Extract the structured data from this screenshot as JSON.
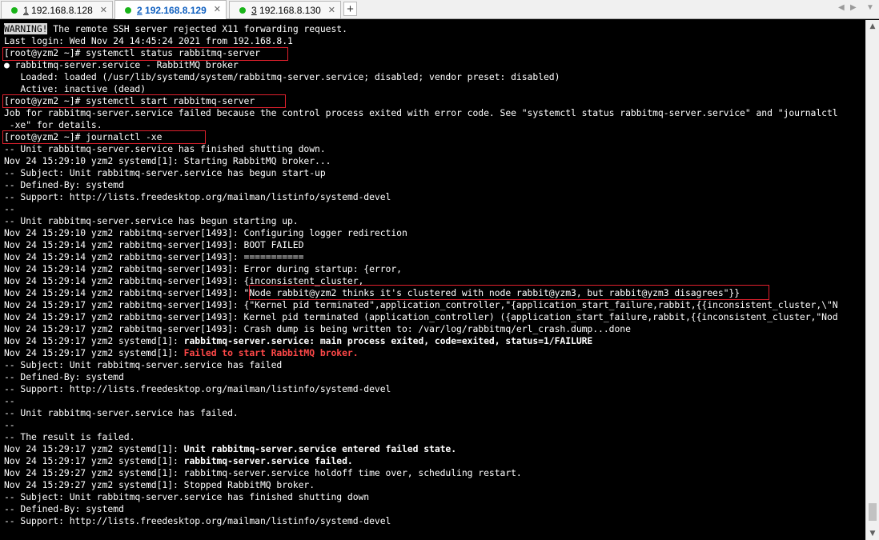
{
  "tabs": [
    {
      "num": "1",
      "label": " 192.168.8.128",
      "close": "✕",
      "status": "connected"
    },
    {
      "num": "2",
      "label": " 192.168.8.129",
      "close": "✕",
      "status": "connected"
    },
    {
      "num": "3",
      "label": " 192.168.8.130",
      "close": "✕",
      "status": "connected"
    }
  ],
  "add_tab": "+",
  "nav": {
    "prev": "◀",
    "next": "▶",
    "menu": "▼"
  },
  "terminal": {
    "warning_tag": "WARNING!",
    "warning_rest": " The remote SSH server rejected X11 forwarding request.",
    "lines": [
      "Last login: Wed Nov 24 14:45:24 2021 from 192.168.8.1",
      "[root@yzm2 ~]# systemctl status rabbitmq-server",
      "● rabbitmq-server.service - RabbitMQ broker",
      "   Loaded: loaded (/usr/lib/systemd/system/rabbitmq-server.service; disabled; vendor preset: disabled)",
      "   Active: inactive (dead)",
      "[root@yzm2 ~]# systemctl start rabbitmq-server",
      "Job for rabbitmq-server.service failed because the control process exited with error code. See \"systemctl status rabbitmq-server.service\" and \"journalctl",
      " -xe\" for details.",
      "[root@yzm2 ~]# journalctl -xe",
      "-- Unit rabbitmq-server.service has finished shutting down.",
      "Nov 24 15:29:10 yzm2 systemd[1]: Starting RabbitMQ broker...",
      "-- Subject: Unit rabbitmq-server.service has begun start-up",
      "-- Defined-By: systemd",
      "-- Support: http://lists.freedesktop.org/mailman/listinfo/systemd-devel",
      "--",
      "-- Unit rabbitmq-server.service has begun starting up.",
      "Nov 24 15:29:10 yzm2 rabbitmq-server[1493]: Configuring logger redirection",
      "Nov 24 15:29:14 yzm2 rabbitmq-server[1493]: BOOT FAILED",
      "Nov 24 15:29:14 yzm2 rabbitmq-server[1493]: ===========",
      "Nov 24 15:29:14 yzm2 rabbitmq-server[1493]: Error during startup: {error,",
      "Nov 24 15:29:14 yzm2 rabbitmq-server[1493]: {inconsistent_cluster,",
      "Nov 24 15:29:14 yzm2 rabbitmq-server[1493]: \"Node rabbit@yzm2 thinks it's clustered with node rabbit@yzm3, but rabbit@yzm3 disagrees\"}}",
      "Nov 24 15:29:17 yzm2 rabbitmq-server[1493]: {\"Kernel pid terminated\",application_controller,\"{application_start_failure,rabbit,{{inconsistent_cluster,\\\"N",
      "Nov 24 15:29:17 yzm2 rabbitmq-server[1493]: Kernel pid terminated (application_controller) ({application_start_failure,rabbit,{{inconsistent_cluster,\"Nod",
      "Nov 24 15:29:17 yzm2 rabbitmq-server[1493]: Crash dump is being written to: /var/log/rabbitmq/erl_crash.dump...done"
    ],
    "l26_prefix": "Nov 24 15:29:17 yzm2 systemd[1]: ",
    "l26_bold": "rabbitmq-server.service: main process exited, code=exited, status=1/FAILURE",
    "l27_prefix": "Nov 24 15:29:17 yzm2 systemd[1]: ",
    "l27_red": "Failed to start RabbitMQ broker.",
    "lines2": [
      "-- Subject: Unit rabbitmq-server.service has failed",
      "-- Defined-By: systemd",
      "-- Support: http://lists.freedesktop.org/mailman/listinfo/systemd-devel",
      "--",
      "-- Unit rabbitmq-server.service has failed.",
      "--",
      "-- The result is failed."
    ],
    "l35_prefix": "Nov 24 15:29:17 yzm2 systemd[1]: ",
    "l35_bold": "Unit rabbitmq-server.service entered failed state.",
    "l36_prefix": "Nov 24 15:29:17 yzm2 systemd[1]: ",
    "l36_bold": "rabbitmq-server.service failed.",
    "lines3": [
      "Nov 24 15:29:27 yzm2 systemd[1]: rabbitmq-server.service holdoff time over, scheduling restart.",
      "Nov 24 15:29:27 yzm2 systemd[1]: Stopped RabbitMQ broker.",
      "-- Subject: Unit rabbitmq-server.service has finished shutting down",
      "-- Defined-By: systemd",
      "-- Support: http://lists.freedesktop.org/mailman/listinfo/systemd-devel"
    ]
  },
  "scrollbar": {
    "up": "▲",
    "down": "▼",
    "position": 0.95
  },
  "colors": {
    "error_red": "#ff4848",
    "highlight_box": "#e0202c",
    "status_dot": "#19b419",
    "active_tab_text": "#1060c0"
  }
}
